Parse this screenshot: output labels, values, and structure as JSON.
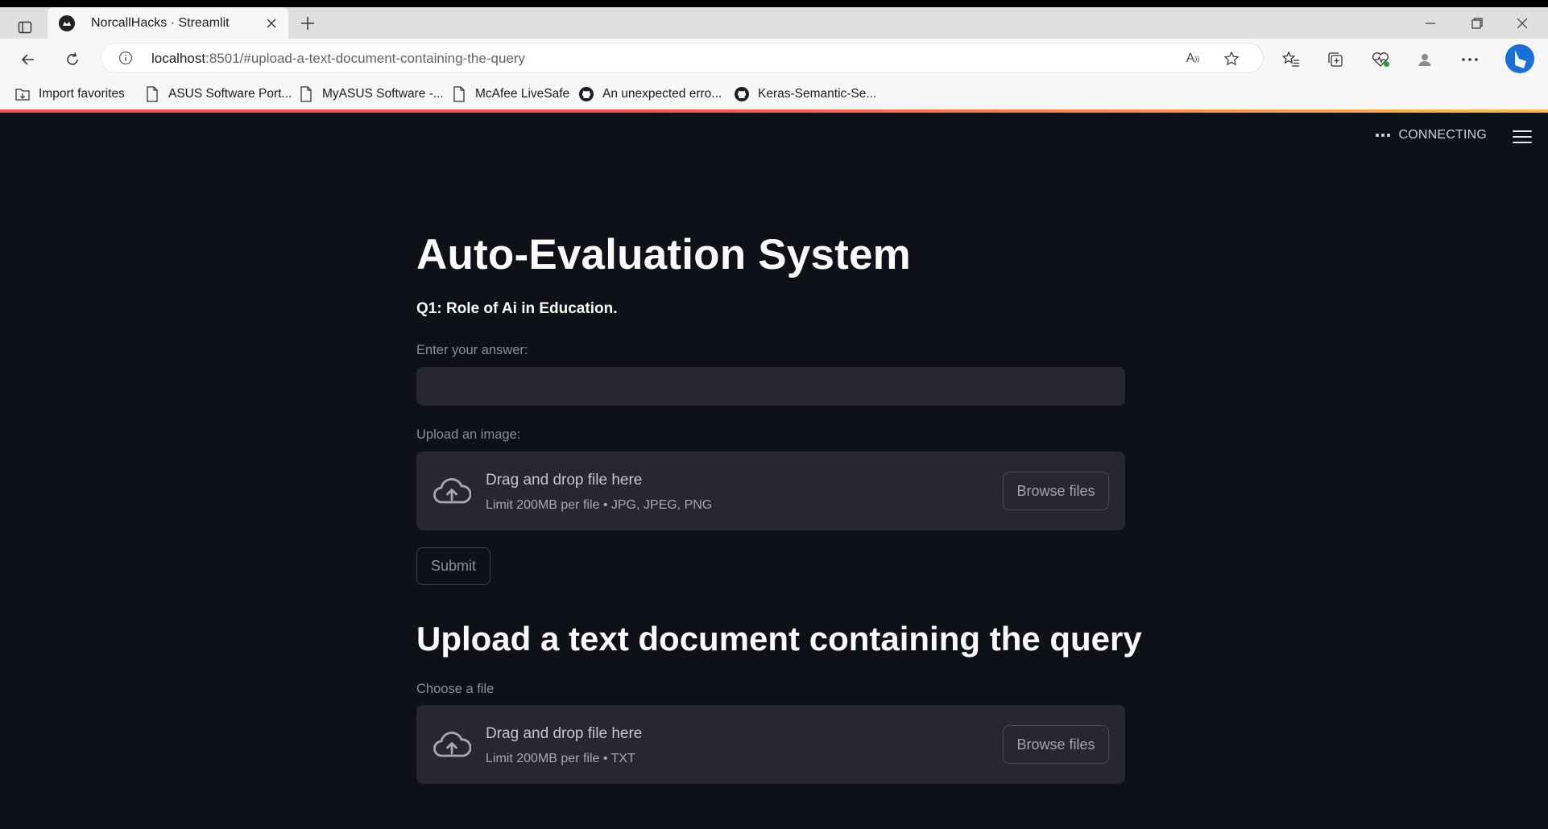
{
  "browser": {
    "tab_title": "NorcallHacks · Streamlit",
    "url_host": "localhost",
    "url_rest": ":8501/#upload-a-text-document-containing-the-query",
    "read_aloud_label": "A",
    "bookmarks": [
      {
        "label": "Import favorites",
        "icon": "import-icon"
      },
      {
        "label": "ASUS Software Port...",
        "icon": "page-icon"
      },
      {
        "label": "MyASUS Software -...",
        "icon": "page-icon"
      },
      {
        "label": "McAfee LiveSafe",
        "icon": "page-icon"
      },
      {
        "label": "An unexpected erro...",
        "icon": "github-icon"
      },
      {
        "label": "Keras-Semantic-Se...",
        "icon": "github-icon"
      }
    ]
  },
  "app": {
    "status": "CONNECTING",
    "title": "Auto-Evaluation System",
    "question": "Q1: Role of Ai in Education.",
    "answer_label": "Enter your answer:",
    "answer_value": "",
    "image_label": "Upload an image:",
    "image_drop": {
      "title": "Drag and drop file here",
      "subtitle": "Limit 200MB per file • JPG, JPEG, PNG",
      "button": "Browse files"
    },
    "submit_label": "Submit",
    "section_heading": "Upload a text document containing the query",
    "file_label": "Choose a file",
    "file_drop": {
      "title": "Drag and drop file here",
      "subtitle": "Limit 200MB per file • TXT",
      "button": "Browse files"
    }
  },
  "colors": {
    "app_background": "#0e1117",
    "widget_background": "#262730",
    "accent_red": "#ff4b4b",
    "accent_yellow": "#ffbd45"
  }
}
